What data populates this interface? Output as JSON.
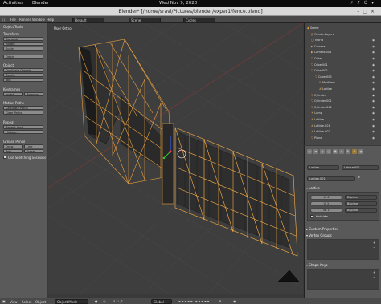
{
  "system": {
    "activities": "Activities",
    "app_name": "Blender",
    "clock": "Wed Nov 9, 2020"
  },
  "window": {
    "title": "Blender* [/home/sravi/Pictures/blender/exper1/fence.blend]"
  },
  "menubar": {
    "items": [
      "File",
      "Render",
      "Window",
      "Help"
    ],
    "layout": "Default",
    "scene": "Scene",
    "engine": "Cycles"
  },
  "toolshelf": {
    "title": "Object Tools",
    "transform_header": "Transform",
    "transform_buttons": [
      "Translate",
      "Rotate",
      "Scale"
    ],
    "origin_button": "Origin",
    "object_header": "Object",
    "object_buttons": [
      "Duplicate Objects",
      "Delete",
      "Join"
    ],
    "keyframes_header": "Keyframes",
    "insert_label": "Insert",
    "remove_label": "Remove",
    "motion_header": "Motion Paths",
    "motion_buttons": [
      "Calculate Paths",
      "Clear Paths"
    ],
    "repeat_header": "Repeat",
    "repeat_buttons": [
      "Repeat Last",
      "History..."
    ],
    "grease_header": "Grease Pencil",
    "draw_label": "Draw",
    "line_label": "Line",
    "poly_label": "Poly",
    "erase_label": "Erase",
    "use_sketching": "Use Sketching Sessions"
  },
  "viewport": {
    "label": "User Ortho"
  },
  "outliner": {
    "items": [
      {
        "label": "Scene",
        "indent": 0
      },
      {
        "label": "RenderLayers",
        "indent": 1
      },
      {
        "label": "World",
        "indent": 1
      },
      {
        "label": "Camera",
        "indent": 1
      },
      {
        "label": "Camera.001",
        "indent": 1
      },
      {
        "label": "Cube",
        "indent": 1
      },
      {
        "label": "Cube.001",
        "indent": 1
      },
      {
        "label": "Cube.002",
        "indent": 1
      },
      {
        "label": "Cube.003",
        "indent": 2
      },
      {
        "label": "Modifiers",
        "indent": 3
      },
      {
        "label": "Lattice",
        "indent": 3
      },
      {
        "label": "Cylinder",
        "indent": 1
      },
      {
        "label": "Cylinder.001",
        "indent": 1
      },
      {
        "label": "Cylinder.002",
        "indent": 1
      },
      {
        "label": "Lamp",
        "indent": 1
      },
      {
        "label": "Lattice",
        "indent": 1
      },
      {
        "label": "Lattice.001",
        "indent": 1
      },
      {
        "label": "Lattice.002",
        "indent": 1
      },
      {
        "label": "Plane",
        "indent": 1
      }
    ]
  },
  "properties": {
    "breadcrumb_object": "Lattice",
    "breadcrumb_data": "Lattice.001",
    "datablock": "Lattice.001",
    "lattice_header": "Lattice",
    "u_label": "U: 6",
    "v_label": "V: 2",
    "w_label": "W: 1",
    "interp_u": "BSpline",
    "interp_v": "BSpline",
    "interp_w": "BSpline",
    "outside_label": "Outside",
    "custom_props": "Custom Properties",
    "vertex_groups": "Vertex Groups",
    "shape_keys": "Shape Keys"
  },
  "view3d_header": {
    "menus": [
      "View",
      "Select",
      "Object"
    ],
    "mode": "Object Mode",
    "pivot": "Global"
  },
  "colors": {
    "selected_wire": "#e8a040",
    "active_wire": "#ffb347",
    "panel_bg": "#595959",
    "viewport_bg": "#3e3e3e"
  }
}
